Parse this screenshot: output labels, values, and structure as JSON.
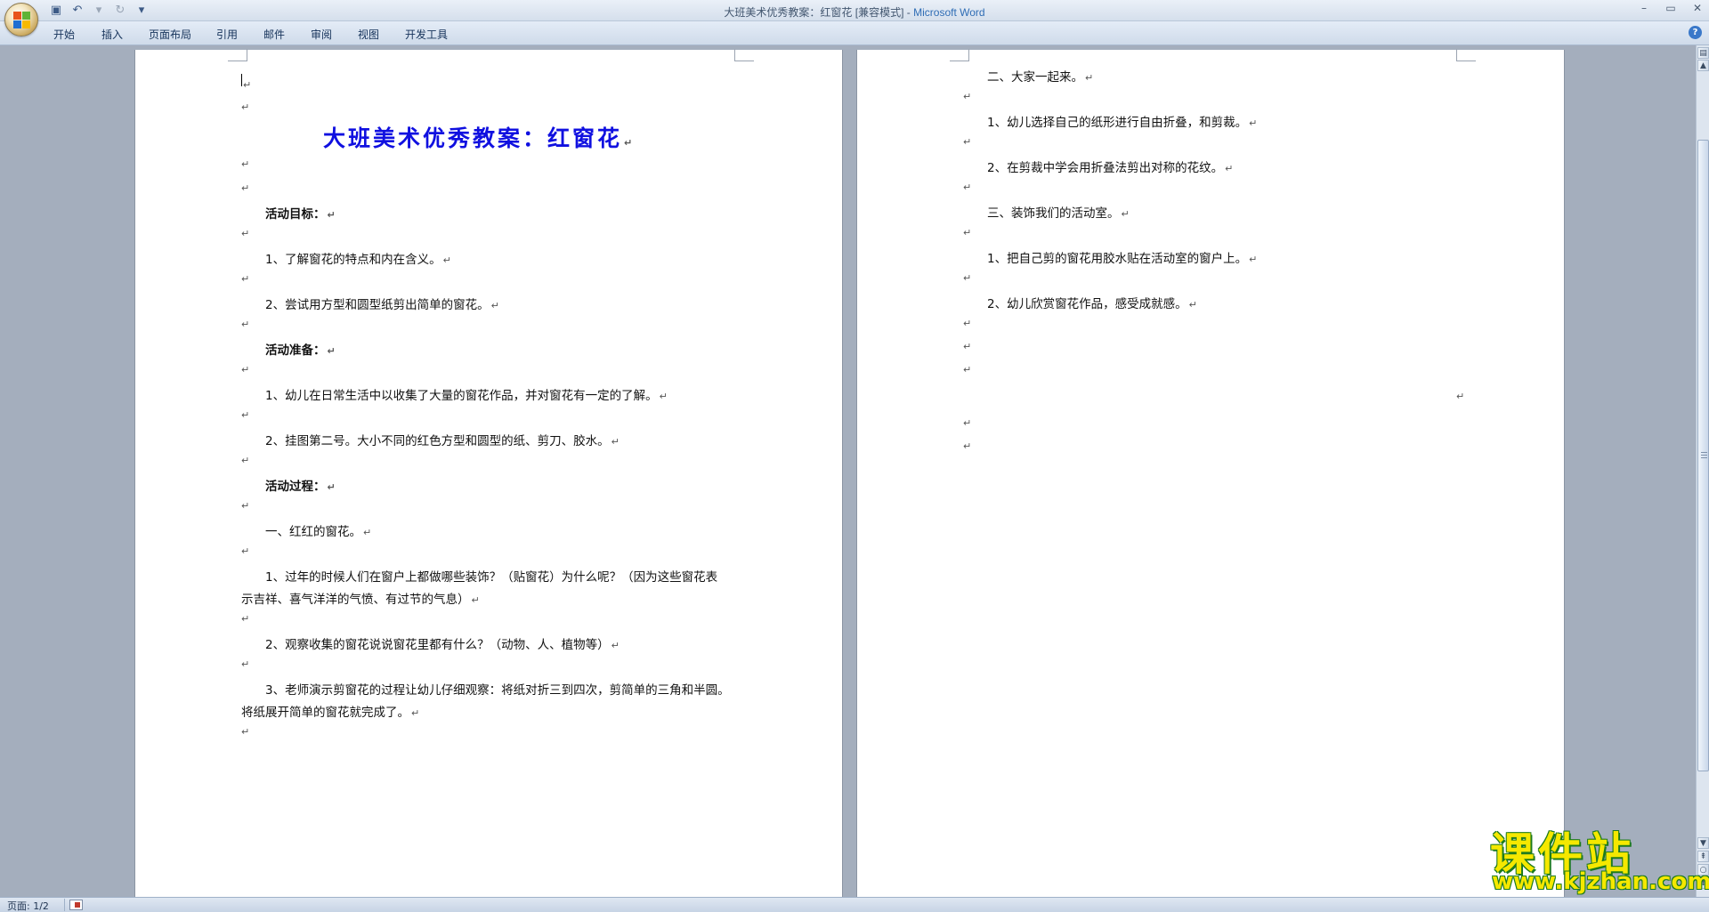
{
  "window": {
    "title": "大班美术优秀教案：红窗花 [兼容模式]",
    "app_name": "Microsoft Word",
    "separator": " - "
  },
  "qat": [
    "save-icon",
    "undo-icon",
    "redo-icon",
    "customize-icon"
  ],
  "ribbon": {
    "tabs": [
      "开始",
      "插入",
      "页面布局",
      "引用",
      "邮件",
      "审阅",
      "视图",
      "开发工具"
    ]
  },
  "document": {
    "title": "大班美术优秀教案：红窗花",
    "page1": {
      "goal_heading": "活动目标：",
      "goal_1": "1、了解窗花的特点和内在含义。",
      "goal_2": "2、尝试用方型和圆型纸剪出简单的窗花。",
      "prep_heading": "活动准备：",
      "prep_1": "1、幼儿在日常生活中以收集了大量的窗花作品，并对窗花有一定的了解。",
      "prep_2": "2、挂图第二号。大小不同的红色方型和圆型的纸、剪刀、胶水。",
      "process_heading": "活动过程：",
      "section_1": "一、红红的窗花。",
      "step_1a": "1、过年的时候人们在窗户上都做哪些装饰？（贴窗花）为什么呢？（因为这些窗花表",
      "step_1b": "示吉祥、喜气洋洋的气愤、有过节的气息）",
      "step_2": "2、观察收集的窗花说说窗花里都有什么？（动物、人、植物等）",
      "step_3a": "3、老师演示剪窗花的过程让幼儿仔细观察：将纸对折三到四次，剪简单的三角和半圆。",
      "step_3b": "将纸展开简单的窗花就完成了。"
    },
    "page2": {
      "section_2": "二、大家一起来。",
      "p2_step_1": "1、幼儿选择自己的纸形进行自由折叠，和剪裁。",
      "p2_step_2": "2、在剪裁中学会用折叠法剪出对称的花纹。",
      "section_3": "三、装饰我们的活动室。",
      "p3_step_1": "1、把自己剪的窗花用胶水贴在活动室的窗户上。",
      "p3_step_2": "2、幼儿欣赏窗花作品，感受成就感。"
    },
    "paragraph_mark": "↵"
  },
  "status": {
    "page_indicator": "页面: 1/2"
  },
  "watermark": {
    "text": "课件站",
    "url": "www.kjzhan.com"
  }
}
